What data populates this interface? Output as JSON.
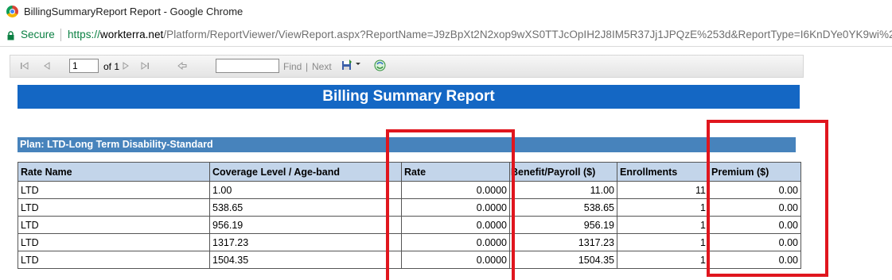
{
  "window": {
    "title": "BillingSummaryReport Report - Google Chrome"
  },
  "address_bar": {
    "secure_label": "Secure",
    "url_scheme": "https://",
    "url_host": "workterra.net",
    "url_path": "/Platform/ReportViewer/ViewReport.aspx?ReportName=J9zBpXt2N2xop9wXS0TTJcOpIH2J8IM5R37Jj1JPQzE%253d&ReportType=I6KnDYe0YK9wi%2"
  },
  "toolbar": {
    "page_value": "1",
    "of_label": "of 1",
    "find_label": "Find",
    "separator": "|",
    "next_label": "Next"
  },
  "report": {
    "title": "Billing Summary Report",
    "plan_label": "Plan: LTD-Long Term Disability-Standard",
    "columns": [
      "Rate Name",
      "Coverage Level / Age-band",
      "Rate",
      "Benefit/Payroll ($)",
      "Enrollments",
      "Premium ($)"
    ],
    "rows": [
      [
        "LTD",
        "1.00",
        "0.0000",
        "11.00",
        "11",
        "0.00"
      ],
      [
        "LTD",
        "538.65",
        "0.0000",
        "538.65",
        "1",
        "0.00"
      ],
      [
        "LTD",
        "956.19",
        "0.0000",
        "956.19",
        "1",
        "0.00"
      ],
      [
        "LTD",
        "1317.23",
        "0.0000",
        "1317.23",
        "1",
        "0.00"
      ],
      [
        "LTD",
        "1504.35",
        "0.0000",
        "1504.35",
        "1",
        "0.00"
      ]
    ]
  },
  "colors": {
    "banner": "#1467c4",
    "plan_header": "#4783bc",
    "column_header": "#c3d5ea",
    "highlight": "#e0161e",
    "secure_green": "#0b8043"
  }
}
